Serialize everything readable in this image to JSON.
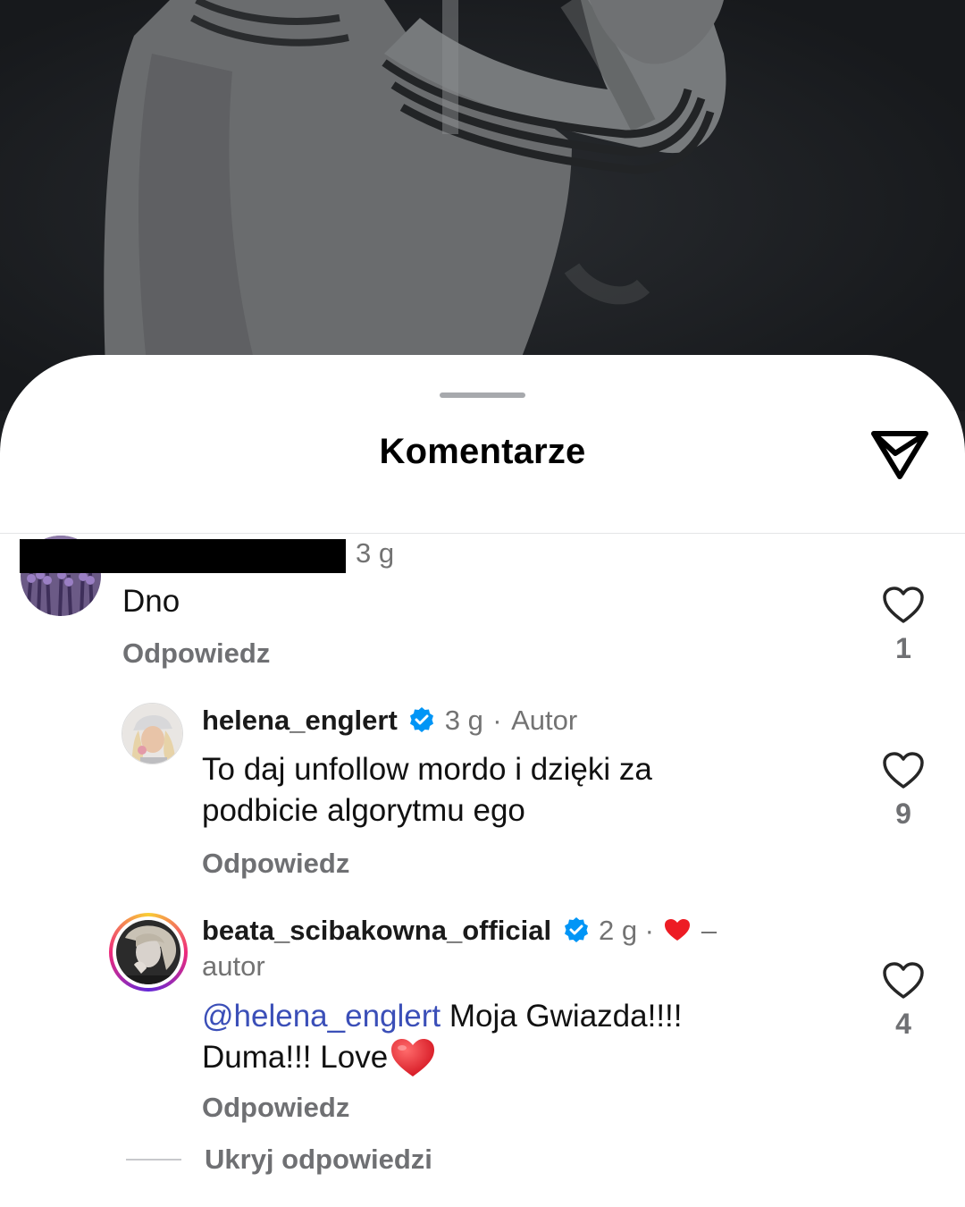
{
  "sheet": {
    "title": "Komentarze",
    "share_icon": "paper-plane-icon"
  },
  "comments": [
    {
      "username": "",
      "username_redacted": true,
      "time": "3 g",
      "text": "Dno",
      "reply_label": "Odpowiedz",
      "likes": "1"
    },
    {
      "username": "helena_englert",
      "verified": true,
      "time": "3 g",
      "separator": "·",
      "author_tag": "Autor",
      "text": "To daj unfollow mordo i dzięki za podbicie algorytmu ego",
      "reply_label": "Odpowiedz",
      "likes": "9"
    },
    {
      "username": "beata_scibakowna_official",
      "verified": true,
      "time": "2 g",
      "separator": "·",
      "liked_by_author_suffix": "–",
      "author_tag": "autor",
      "mention": "@helena_englert",
      "text_part1": " Moja Gwiazda!!!!",
      "text_part2": "Duma!!! Love",
      "reply_label": "Odpowiedz",
      "likes": "4"
    }
  ],
  "hide_replies_label": "Ukryj odpowiedzi",
  "colors": {
    "mention": "#3b4fb8",
    "verified": "#0095f6",
    "heart": "#ed1c24",
    "muted": "#737373"
  }
}
